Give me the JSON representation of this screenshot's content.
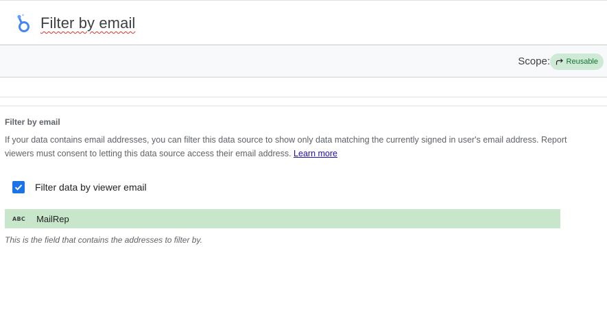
{
  "header": {
    "title": "Filter by email"
  },
  "scope": {
    "label": "Scope:",
    "chip_label": "Reusable"
  },
  "section": {
    "heading": "Filter by email",
    "description": "If your data contains email addresses, you can filter this data source to show only data matching the currently signed in user's email address. Report viewers must consent to letting this data source access their email address.",
    "learn_more": "Learn more"
  },
  "filter": {
    "checkbox_label": "Filter data by viewer email",
    "checked": true,
    "field_type": "ABC",
    "field_name": "MailRep",
    "hint": "This is the field that contains the addresses to filter by."
  },
  "colors": {
    "accent": "#1a73e8",
    "field_bg": "#c8e6c9",
    "chip_bg": "#ceead6",
    "chip_text": "#137333"
  }
}
